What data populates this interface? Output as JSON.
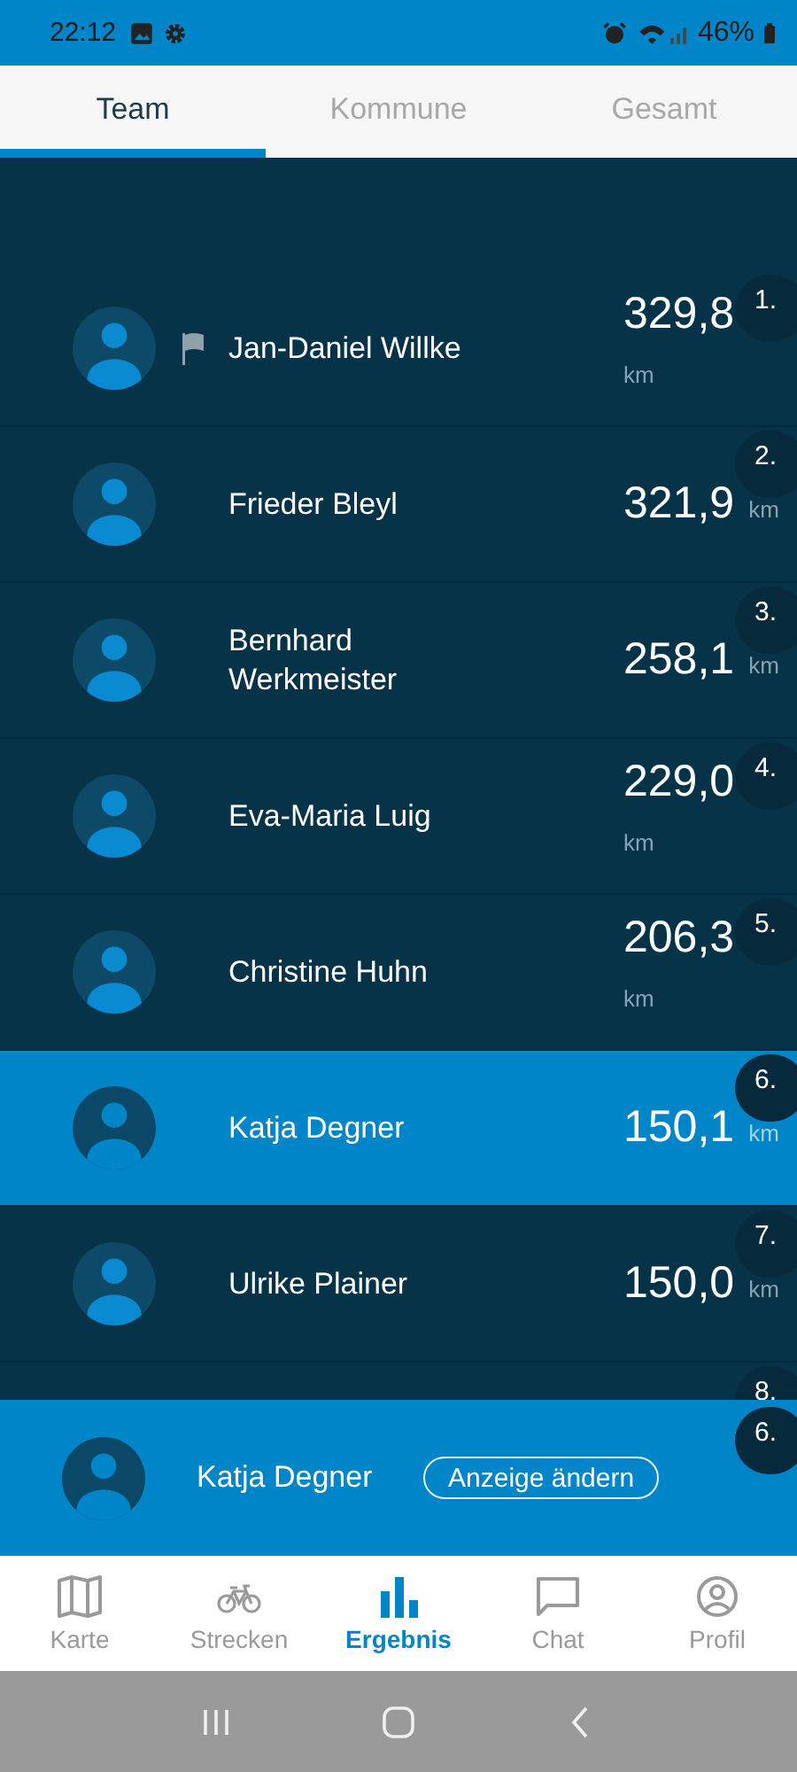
{
  "status_bar": {
    "time": "22:12",
    "battery": "46%"
  },
  "tabs": [
    {
      "label": "Team",
      "selected": true
    },
    {
      "label": "Kommune",
      "selected": false
    },
    {
      "label": "Gesamt",
      "selected": false
    }
  ],
  "ranking": [
    {
      "name": "Jan-Daniel Willke",
      "value": "329,8",
      "unit": "km",
      "rank": "1.",
      "flag": true,
      "unit_below": true,
      "selected": false
    },
    {
      "name": "Frieder Bleyl",
      "value": "321,9",
      "unit": "km",
      "rank": "2.",
      "flag": false,
      "unit_below": false,
      "selected": false
    },
    {
      "name": "Bernhard Werkmeister",
      "value": "258,1",
      "unit": "km",
      "rank": "3.",
      "flag": false,
      "unit_below": false,
      "selected": false
    },
    {
      "name": "Eva-Maria Luig",
      "value": "229,0",
      "unit": "km",
      "rank": "4.",
      "flag": false,
      "unit_below": true,
      "selected": false
    },
    {
      "name": "Christine Huhn",
      "value": "206,3",
      "unit": "km",
      "rank": "5.",
      "flag": false,
      "unit_below": true,
      "selected": false
    },
    {
      "name": "Katja Degner",
      "value": "150,1",
      "unit": "km",
      "rank": "6.",
      "flag": false,
      "unit_below": false,
      "selected": true
    },
    {
      "name": "Ulrike Plainer",
      "value": "150,0",
      "unit": "km",
      "rank": "7.",
      "flag": false,
      "unit_below": false,
      "selected": false
    }
  ],
  "partial_rank": "8.",
  "own_entry": {
    "name": "Katja Degner",
    "button": "Anzeige ändern",
    "rank": "6."
  },
  "bottom_nav": [
    {
      "label": "Karte",
      "kind": "map",
      "selected": false
    },
    {
      "label": "Strecken",
      "kind": "bike",
      "selected": false
    },
    {
      "label": "Ergebnis",
      "kind": "chart",
      "selected": true
    },
    {
      "label": "Chat",
      "kind": "chat",
      "selected": false
    },
    {
      "label": "Profil",
      "kind": "profile",
      "selected": false
    }
  ]
}
